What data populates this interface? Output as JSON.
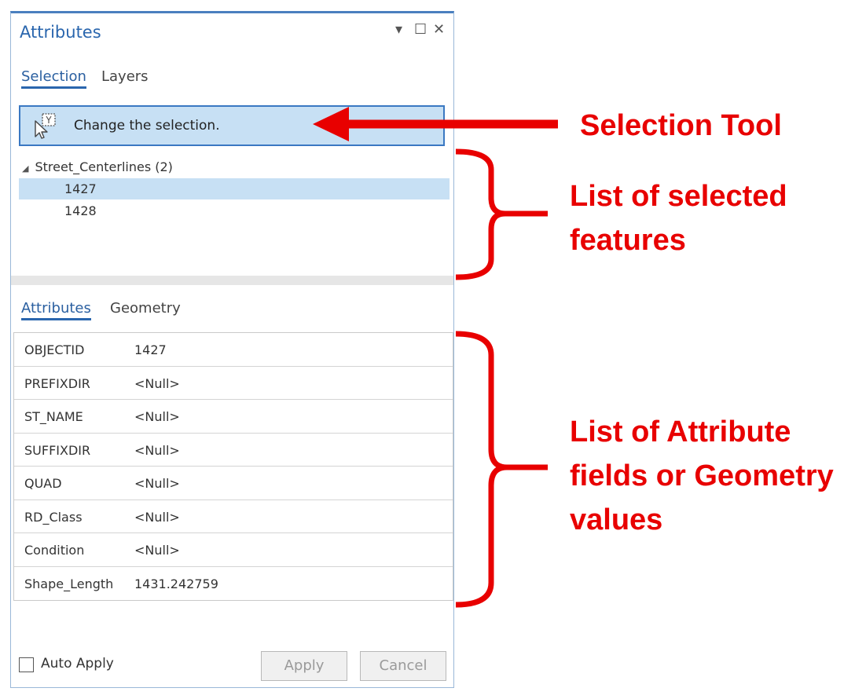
{
  "pane": {
    "title": "Attributes",
    "window_buttons": {
      "dropdown": "▾",
      "maximize": "☐",
      "close": "✕"
    },
    "top_tabs": [
      {
        "label": "Selection",
        "active": true
      },
      {
        "label": "Layers",
        "active": false
      }
    ],
    "selection_tool": {
      "label": "Change the selection.",
      "icon": "select-features-icon"
    },
    "tree": {
      "layer": "Street_Centerlines (2)",
      "features": [
        {
          "id": "1427",
          "selected": true
        },
        {
          "id": "1428",
          "selected": false
        }
      ]
    },
    "bottom_tabs": [
      {
        "label": "Attributes",
        "active": true
      },
      {
        "label": "Geometry",
        "active": false
      }
    ],
    "fields": [
      {
        "name": "OBJECTID",
        "value": "1427"
      },
      {
        "name": "PREFIXDIR",
        "value": "<Null>"
      },
      {
        "name": "ST_NAME",
        "value": "<Null>"
      },
      {
        "name": "SUFFIXDIR",
        "value": "<Null>"
      },
      {
        "name": "QUAD",
        "value": "<Null>"
      },
      {
        "name": "RD_Class",
        "value": "<Null>"
      },
      {
        "name": "Condition",
        "value": "<Null>"
      },
      {
        "name": "Shape_Length",
        "value": "1431.242759"
      }
    ],
    "auto_apply": {
      "label": "Auto Apply",
      "checked": false
    },
    "apply_label": "Apply",
    "cancel_label": "Cancel"
  },
  "annotations": {
    "selection_tool": "Selection Tool",
    "selected_features": {
      "line1": "List of selected",
      "line2": "features"
    },
    "attribute_fields": {
      "line1": "List of Attribute",
      "line2": "fields or Geometry",
      "line3": "values"
    },
    "color": "#e80000"
  },
  "colors": {
    "accent": "#2a66ae",
    "selection_highlight": "#c7e0f4"
  }
}
